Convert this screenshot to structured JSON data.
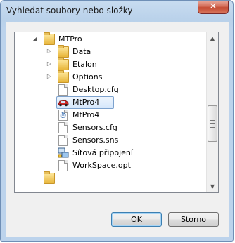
{
  "window": {
    "title": "Vyhledat soubory nebo složky",
    "close_glyph": "✕"
  },
  "tree": {
    "items": [
      {
        "label": "MTPro",
        "icon": "folder-icon",
        "expander": "expanded"
      },
      {
        "label": "Data",
        "icon": "folder-icon",
        "expander": "collapsed"
      },
      {
        "label": "Etalon",
        "icon": "folder-icon",
        "expander": "collapsed"
      },
      {
        "label": "Options",
        "icon": "folder-icon",
        "expander": "collapsed"
      },
      {
        "label": "Desktop.cfg",
        "icon": "file-icon",
        "expander": "none"
      },
      {
        "label": "MtPro4",
        "icon": "car-shortcut-icon",
        "expander": "none",
        "selected": true
      },
      {
        "label": "MtPro4",
        "icon": "gear-config-icon",
        "expander": "none"
      },
      {
        "label": "Sensors.cfg",
        "icon": "file-icon",
        "expander": "none"
      },
      {
        "label": "Sensors.sns",
        "icon": "file-icon",
        "expander": "none"
      },
      {
        "label": "Síťová připojení",
        "icon": "network-connections-icon",
        "expander": "none"
      },
      {
        "label": "WorkSpace.opt",
        "icon": "file-icon",
        "expander": "none"
      }
    ]
  },
  "buttons": {
    "ok_label": "OK",
    "cancel_label": "Storno"
  },
  "colors": {
    "accent": "#3c7fb1",
    "selection": "#d5e7fb",
    "title_bar": "#b9d1ea",
    "close": "#c44a32"
  }
}
